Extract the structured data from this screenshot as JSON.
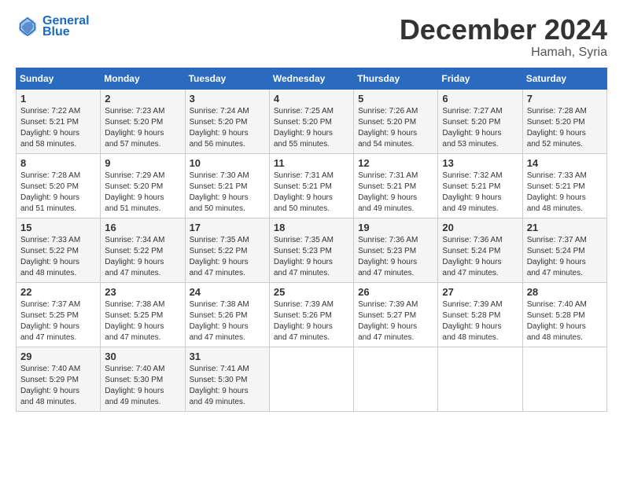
{
  "header": {
    "logo_line1": "General",
    "logo_line2": "Blue",
    "title": "December 2024",
    "subtitle": "Hamah, Syria"
  },
  "calendar": {
    "days_of_week": [
      "Sunday",
      "Monday",
      "Tuesday",
      "Wednesday",
      "Thursday",
      "Friday",
      "Saturday"
    ],
    "weeks": [
      [
        {
          "day": "1",
          "info": "Sunrise: 7:22 AM\nSunset: 5:21 PM\nDaylight: 9 hours\nand 58 minutes."
        },
        {
          "day": "2",
          "info": "Sunrise: 7:23 AM\nSunset: 5:20 PM\nDaylight: 9 hours\nand 57 minutes."
        },
        {
          "day": "3",
          "info": "Sunrise: 7:24 AM\nSunset: 5:20 PM\nDaylight: 9 hours\nand 56 minutes."
        },
        {
          "day": "4",
          "info": "Sunrise: 7:25 AM\nSunset: 5:20 PM\nDaylight: 9 hours\nand 55 minutes."
        },
        {
          "day": "5",
          "info": "Sunrise: 7:26 AM\nSunset: 5:20 PM\nDaylight: 9 hours\nand 54 minutes."
        },
        {
          "day": "6",
          "info": "Sunrise: 7:27 AM\nSunset: 5:20 PM\nDaylight: 9 hours\nand 53 minutes."
        },
        {
          "day": "7",
          "info": "Sunrise: 7:28 AM\nSunset: 5:20 PM\nDaylight: 9 hours\nand 52 minutes."
        }
      ],
      [
        {
          "day": "8",
          "info": "Sunrise: 7:28 AM\nSunset: 5:20 PM\nDaylight: 9 hours\nand 51 minutes."
        },
        {
          "day": "9",
          "info": "Sunrise: 7:29 AM\nSunset: 5:20 PM\nDaylight: 9 hours\nand 51 minutes."
        },
        {
          "day": "10",
          "info": "Sunrise: 7:30 AM\nSunset: 5:21 PM\nDaylight: 9 hours\nand 50 minutes."
        },
        {
          "day": "11",
          "info": "Sunrise: 7:31 AM\nSunset: 5:21 PM\nDaylight: 9 hours\nand 50 minutes."
        },
        {
          "day": "12",
          "info": "Sunrise: 7:31 AM\nSunset: 5:21 PM\nDaylight: 9 hours\nand 49 minutes."
        },
        {
          "day": "13",
          "info": "Sunrise: 7:32 AM\nSunset: 5:21 PM\nDaylight: 9 hours\nand 49 minutes."
        },
        {
          "day": "14",
          "info": "Sunrise: 7:33 AM\nSunset: 5:21 PM\nDaylight: 9 hours\nand 48 minutes."
        }
      ],
      [
        {
          "day": "15",
          "info": "Sunrise: 7:33 AM\nSunset: 5:22 PM\nDaylight: 9 hours\nand 48 minutes."
        },
        {
          "day": "16",
          "info": "Sunrise: 7:34 AM\nSunset: 5:22 PM\nDaylight: 9 hours\nand 47 minutes."
        },
        {
          "day": "17",
          "info": "Sunrise: 7:35 AM\nSunset: 5:22 PM\nDaylight: 9 hours\nand 47 minutes."
        },
        {
          "day": "18",
          "info": "Sunrise: 7:35 AM\nSunset: 5:23 PM\nDaylight: 9 hours\nand 47 minutes."
        },
        {
          "day": "19",
          "info": "Sunrise: 7:36 AM\nSunset: 5:23 PM\nDaylight: 9 hours\nand 47 minutes."
        },
        {
          "day": "20",
          "info": "Sunrise: 7:36 AM\nSunset: 5:24 PM\nDaylight: 9 hours\nand 47 minutes."
        },
        {
          "day": "21",
          "info": "Sunrise: 7:37 AM\nSunset: 5:24 PM\nDaylight: 9 hours\nand 47 minutes."
        }
      ],
      [
        {
          "day": "22",
          "info": "Sunrise: 7:37 AM\nSunset: 5:25 PM\nDaylight: 9 hours\nand 47 minutes."
        },
        {
          "day": "23",
          "info": "Sunrise: 7:38 AM\nSunset: 5:25 PM\nDaylight: 9 hours\nand 47 minutes."
        },
        {
          "day": "24",
          "info": "Sunrise: 7:38 AM\nSunset: 5:26 PM\nDaylight: 9 hours\nand 47 minutes."
        },
        {
          "day": "25",
          "info": "Sunrise: 7:39 AM\nSunset: 5:26 PM\nDaylight: 9 hours\nand 47 minutes."
        },
        {
          "day": "26",
          "info": "Sunrise: 7:39 AM\nSunset: 5:27 PM\nDaylight: 9 hours\nand 47 minutes."
        },
        {
          "day": "27",
          "info": "Sunrise: 7:39 AM\nSunset: 5:28 PM\nDaylight: 9 hours\nand 48 minutes."
        },
        {
          "day": "28",
          "info": "Sunrise: 7:40 AM\nSunset: 5:28 PM\nDaylight: 9 hours\nand 48 minutes."
        }
      ],
      [
        {
          "day": "29",
          "info": "Sunrise: 7:40 AM\nSunset: 5:29 PM\nDaylight: 9 hours\nand 48 minutes."
        },
        {
          "day": "30",
          "info": "Sunrise: 7:40 AM\nSunset: 5:30 PM\nDaylight: 9 hours\nand 49 minutes."
        },
        {
          "day": "31",
          "info": "Sunrise: 7:41 AM\nSunset: 5:30 PM\nDaylight: 9 hours\nand 49 minutes."
        },
        {
          "day": "",
          "info": ""
        },
        {
          "day": "",
          "info": ""
        },
        {
          "day": "",
          "info": ""
        },
        {
          "day": "",
          "info": ""
        }
      ]
    ]
  }
}
